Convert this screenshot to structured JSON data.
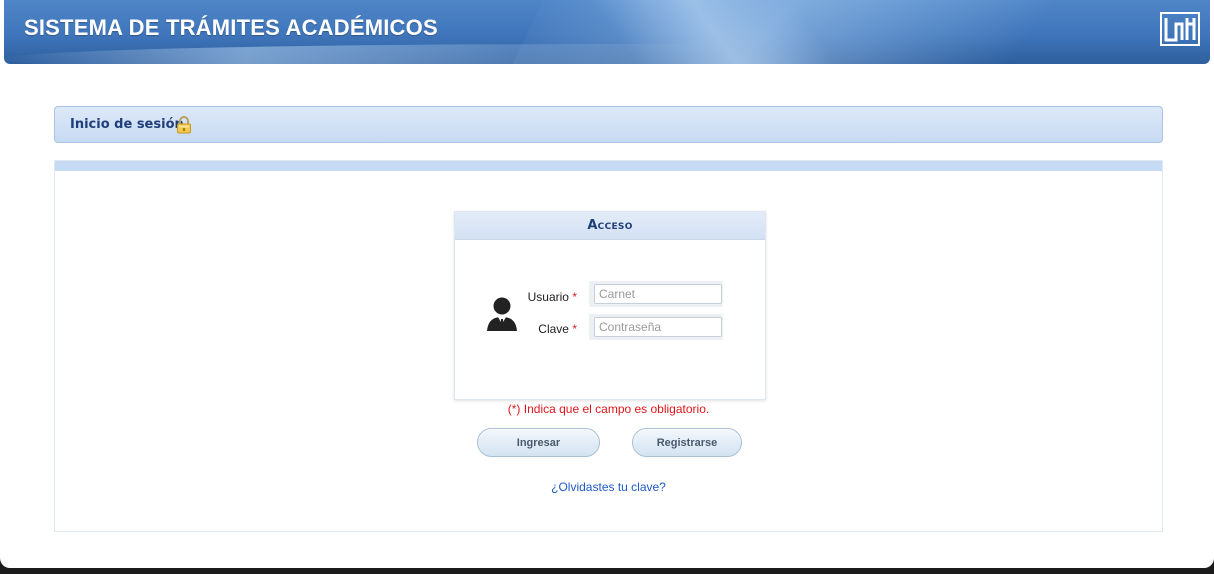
{
  "header": {
    "title": "SISTEMA DE TRÁMITES ACADÉMICOS",
    "logo_icon": "unan-logo"
  },
  "session": {
    "title": "Inicio de sesión",
    "icon": "lock-icon"
  },
  "login": {
    "title": "Acceso",
    "user_icon": "user-avatar-icon",
    "username": {
      "label": "Usuario",
      "required_mark": "*",
      "placeholder": "Carnet",
      "value": ""
    },
    "password": {
      "label": "Clave",
      "required_mark": "*",
      "placeholder": "Contraseña",
      "value": ""
    },
    "required_note": "(*) Indica que el campo es obligatorio.",
    "login_button": "Ingresar",
    "register_button": "Registrarse",
    "forgot_link": "¿Olvidastes tu clave?"
  },
  "colors": {
    "header_blue": "#3f75ba",
    "title_navy": "#1f3f7a",
    "required_red": "#e0161b",
    "link_blue": "#1e5ac8"
  }
}
